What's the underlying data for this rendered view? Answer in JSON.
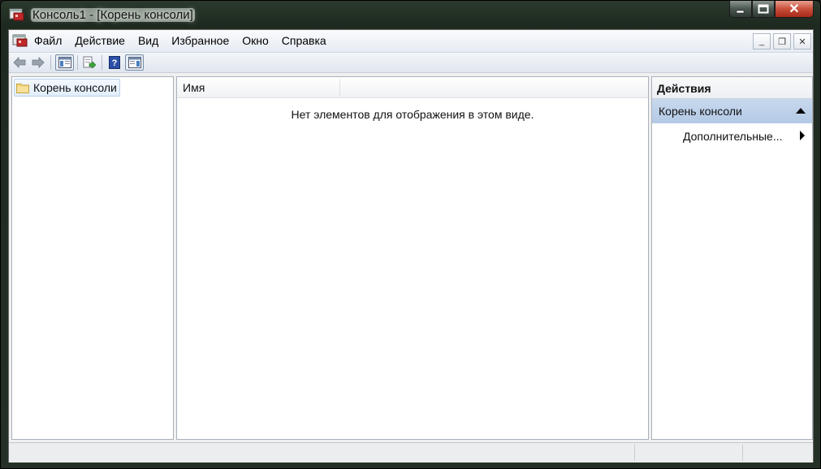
{
  "window": {
    "title": "Консоль1 - [Корень консоли]",
    "caption_buttons": {
      "minimize_icon": "minimize-icon",
      "maximize_icon": "maximize-icon",
      "close_icon": "close-icon",
      "close_glyph": "✕"
    }
  },
  "menubar": {
    "items": [
      "Файл",
      "Действие",
      "Вид",
      "Избранное",
      "Окно",
      "Справка"
    ],
    "mdi_buttons": {
      "minimize": "_",
      "restore": "❐",
      "close": "✕"
    }
  },
  "toolbar": {
    "buttons": [
      "back-arrow-icon",
      "forward-arrow-icon",
      "show-hide-console-tree-icon",
      "export-list-icon",
      "help-icon",
      "show-hide-action-pane-icon"
    ]
  },
  "tree": {
    "root_label": "Корень консоли"
  },
  "list": {
    "column_name": "Имя",
    "empty_message": "Нет элементов для отображения в этом виде."
  },
  "actions": {
    "title": "Действия",
    "section_title": "Корень консоли",
    "item_more": "Дополнительные..."
  },
  "colors": {
    "frame": "#243026",
    "section_header": "#b3c9e5",
    "close_button": "#c8503a"
  }
}
